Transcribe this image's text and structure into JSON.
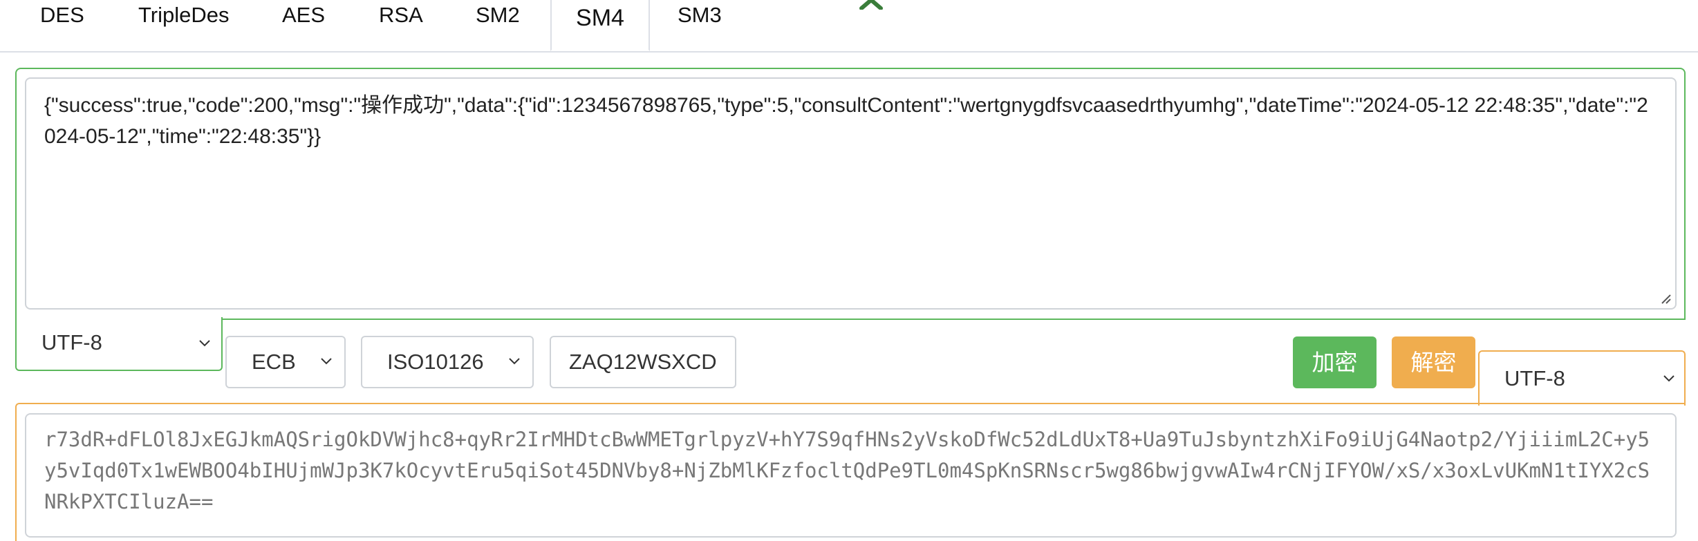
{
  "tabs": [
    {
      "label": "DES"
    },
    {
      "label": "TripleDes"
    },
    {
      "label": "AES"
    },
    {
      "label": "RSA"
    },
    {
      "label": "SM2"
    },
    {
      "label": "SM4"
    },
    {
      "label": "SM3"
    }
  ],
  "active_tab": "SM4",
  "input": {
    "text": "{\"success\":true,\"code\":200,\"msg\":\"操作成功\",\"data\":{\"id\":1234567898765,\"type\":5,\"consultContent\":\"wertgnygdfsvcaasedrthyumhg\",\"dateTime\":\"2024-05-12 22:48:35\",\"date\":\"2024-05-12\",\"time\":\"22:48:35\"}}",
    "encoding": "UTF-8"
  },
  "options": {
    "mode": "ECB",
    "padding": "ISO10126",
    "key": "ZAQ12WSXCD"
  },
  "buttons": {
    "encrypt_label": "加密",
    "decrypt_label": "解密"
  },
  "output": {
    "encoding": "UTF-8",
    "text": "r73dR+dFLOl8JxEGJkmAQSrigOkDVWjhc8+qyRr2IrMHDtcBwWMETgrlpyzV+hY7S9qfHNs2yVskoDfWc52dLdUxT8+Ua9TuJsbyntzhXiFo9iUjG4Naotp2/YjiiimL2C+y5y5vIqd0Tx1wEWBOO4bIHUjmWJp3K7kOcyvtEru5qiSot45DNVby8+NjZbMlKFzfocltQdPe9TL0m4SpKnSRNscr5wg86bwjgvwAIw4rCNjIFYOW/xS/x3oxLvUKmN1tIYX2cSNRkPXTCIluzA=="
  },
  "colors": {
    "green": "#5cb85c",
    "orange": "#f0ad4e",
    "close_icon": "#3a7d3a"
  }
}
